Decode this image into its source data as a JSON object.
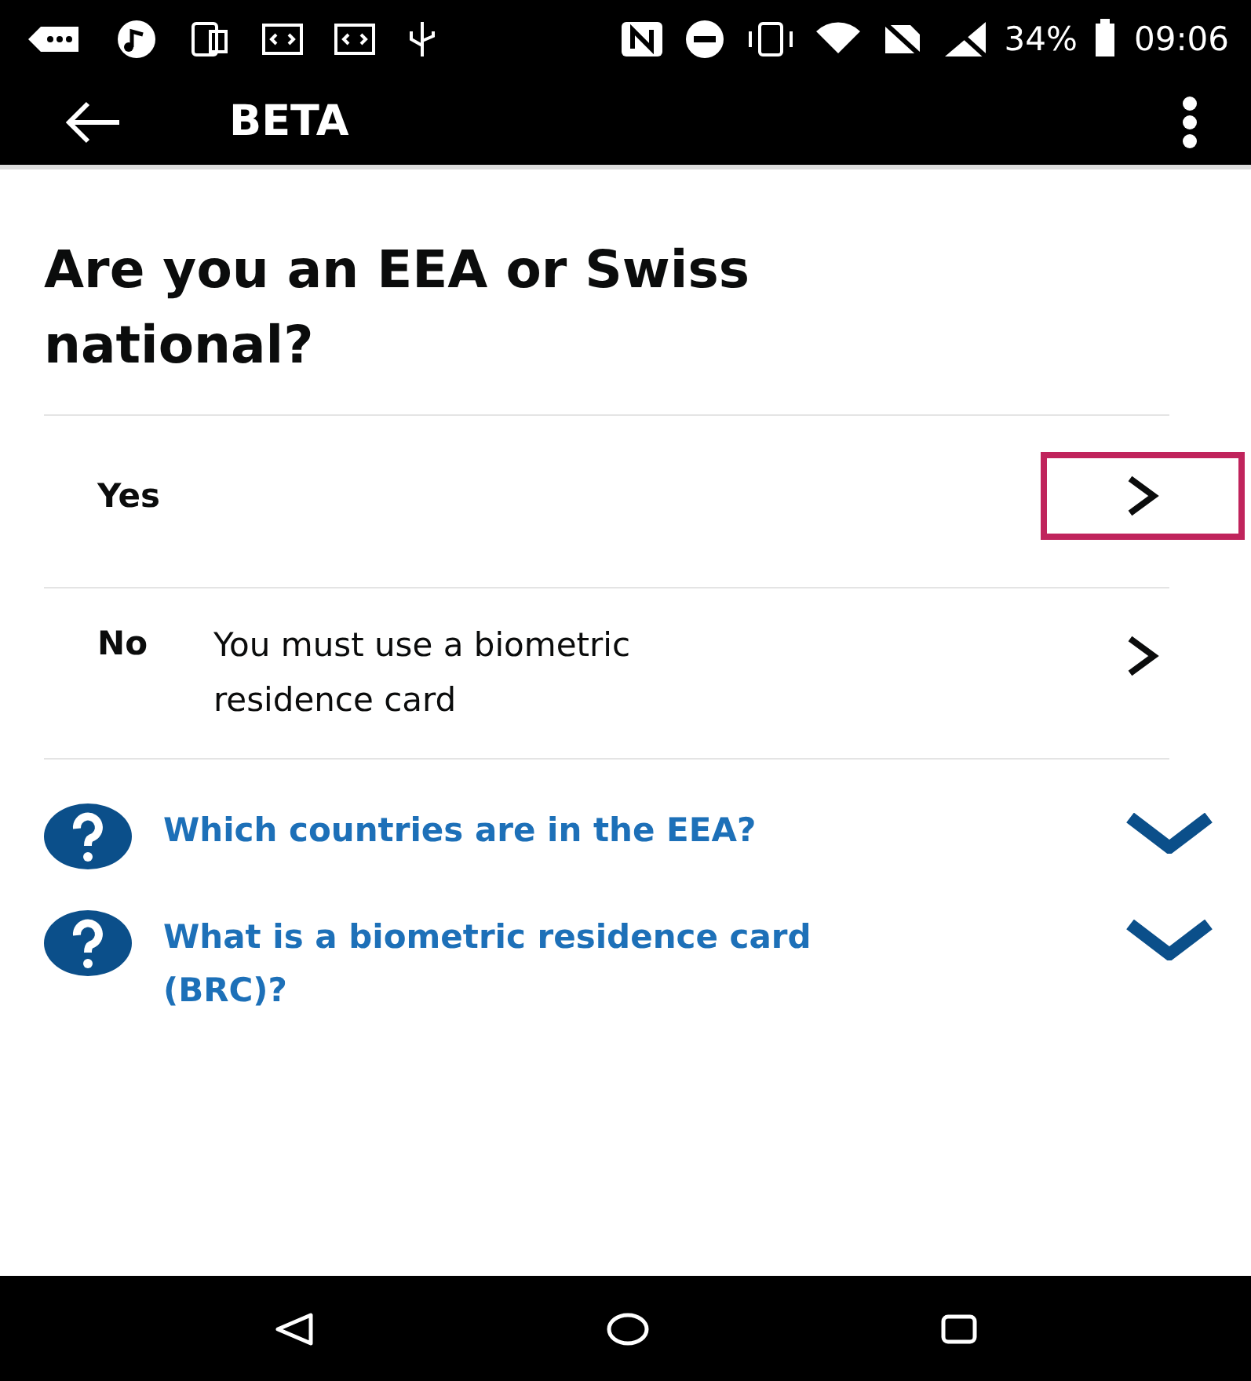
{
  "status_bar": {
    "battery": "34%",
    "time": "09:06"
  },
  "app_bar": {
    "title": "BETA"
  },
  "question": "Are you an EEA or Swiss national?",
  "options": [
    {
      "label": "Yes",
      "highlighted": true
    },
    {
      "label": "No",
      "hint": "You must use a biometric residence card",
      "highlighted": false
    }
  ],
  "faqs": [
    {
      "title": "Which countries are in the EEA?",
      "expanded": false
    },
    {
      "title": "What is a biometric residence card (BRC)?",
      "expanded": false
    }
  ]
}
